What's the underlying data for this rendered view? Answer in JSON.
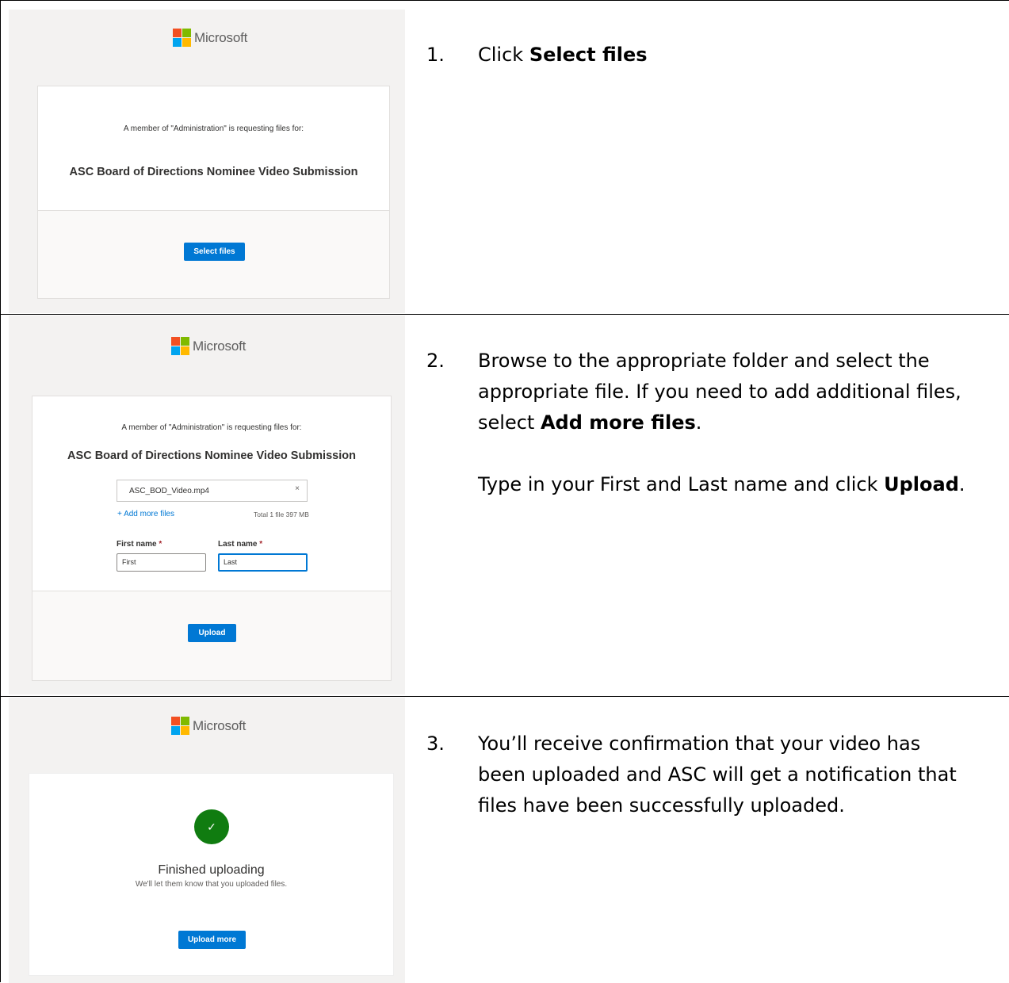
{
  "brand": {
    "name": "Microsoft"
  },
  "step1": {
    "number": "1.",
    "text_before": "Click ",
    "text_bold": "Select files",
    "screenshot": {
      "request_text": "A member of \"Administration\" is requesting files for:",
      "title": "ASC Board of Directions Nominee Video Submission",
      "button": "Select files"
    }
  },
  "step2": {
    "number": "2.",
    "line1": "Browse to the appropriate folder and select the",
    "line2": "appropriate file. If you need to add additional files,",
    "line3_before": "select ",
    "line3_bold": "Add more files",
    "line3_after": ".",
    "para2_before": "Type in your First and Last name and click ",
    "para2_bold": "Upload",
    "para2_after": ".",
    "screenshot": {
      "request_text": "A member of \"Administration\" is requesting files for:",
      "title": "ASC Board of Directions Nominee Video Submission",
      "file_name": "ASC_BOD_Video.mp4",
      "remove_glyph": "×",
      "add_more": "+  Add more files",
      "total": "Total 1 file 397 MB",
      "first_label": "First name",
      "last_label": "Last name",
      "required_mark": "*",
      "first_value": "First",
      "last_value": "Last",
      "button": "Upload"
    }
  },
  "step3": {
    "number": "3.",
    "line1": "You’ll receive confirmation that your video has",
    "line2": "been uploaded and ASC will get a notification that",
    "line3": "files have been successfully uploaded.",
    "screenshot": {
      "check_glyph": "✓",
      "title": "Finished uploading",
      "subtitle": "We'll let them know that you uploaded files.",
      "button": "Upload more"
    }
  },
  "colors": {
    "accent": "#0078d4",
    "success": "#107c10",
    "panel_bg": "#f3f2f1"
  }
}
